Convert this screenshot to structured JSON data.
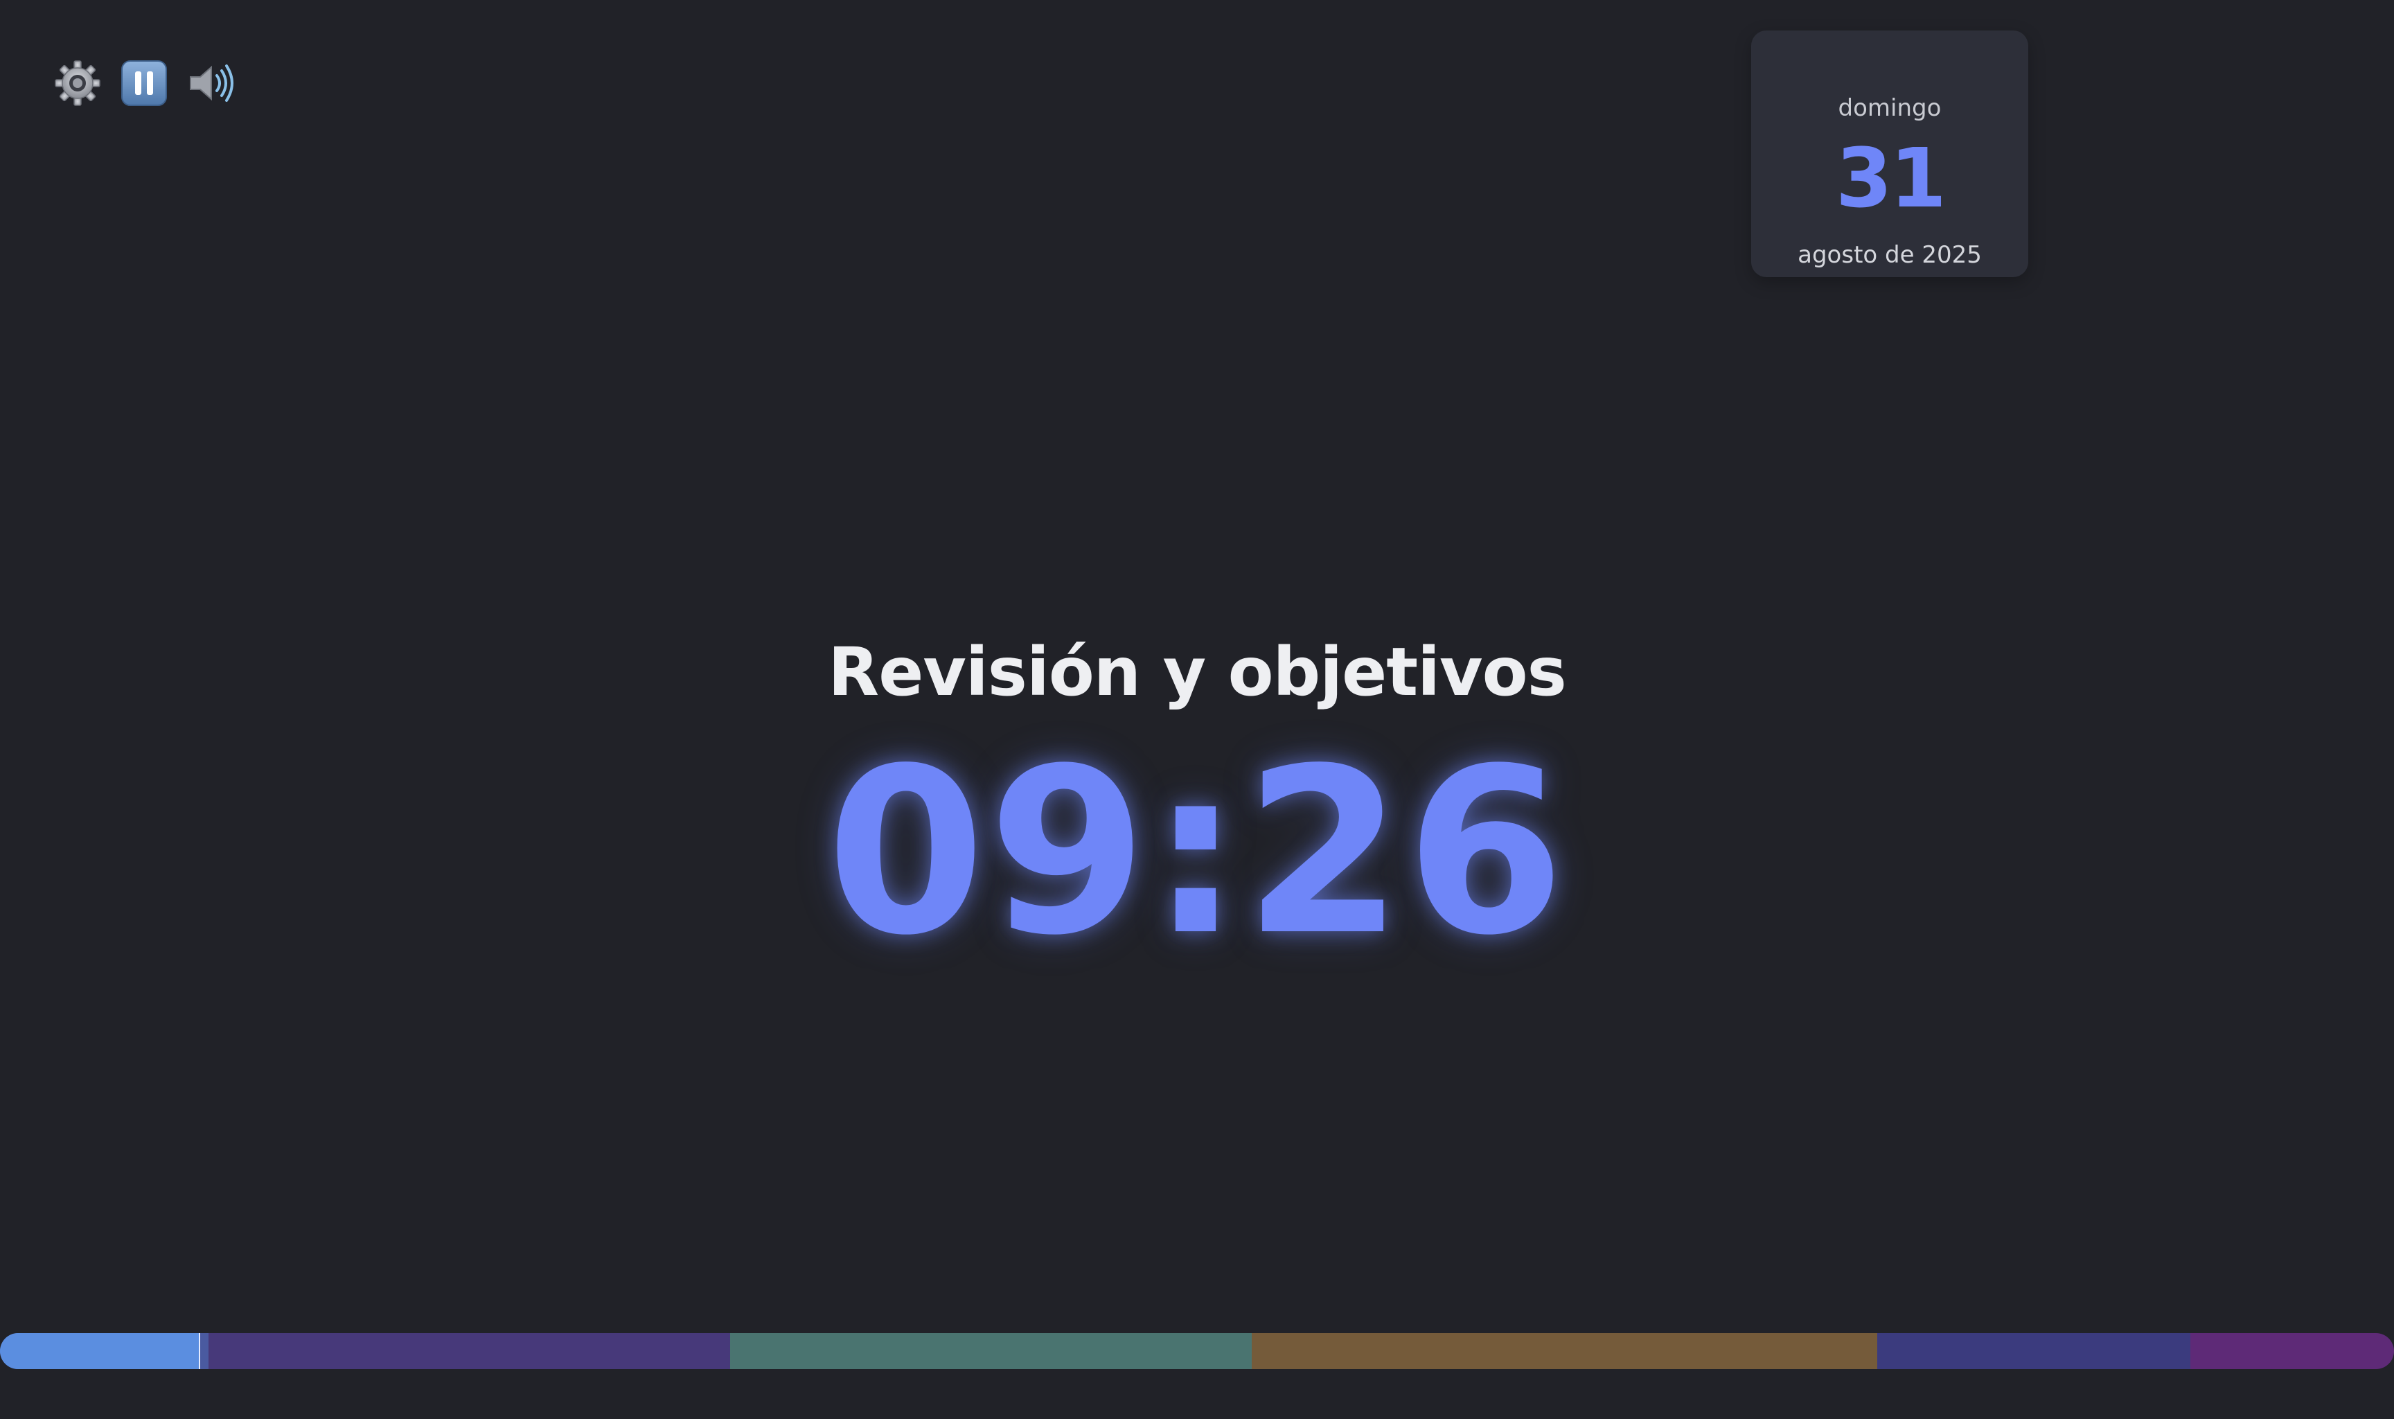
{
  "controls": [
    {
      "name": "settings-button",
      "icon": "gear-icon",
      "symbol": "⚙"
    },
    {
      "name": "pause-button",
      "icon": "pause-icon",
      "symbol": "⏸"
    },
    {
      "name": "volume-button",
      "icon": "speaker-icon",
      "symbol": "🔊"
    }
  ],
  "date": {
    "weekday": "domingo",
    "day": "31",
    "month_year": "agosto de 2025"
  },
  "activity": {
    "title": "Revisión y objetivos"
  },
  "timer": {
    "display": "09:26"
  },
  "colors": {
    "background": "#212228",
    "accent": "#6f86f8",
    "card": "#2d2f39"
  },
  "timeline": {
    "current_segment_progress": 0.955,
    "segments": [
      {
        "name": "segment-1",
        "share": 0.087,
        "color": "#4a5aa0"
      },
      {
        "name": "segment-2",
        "share": 0.218,
        "color": "#47397a"
      },
      {
        "name": "segment-3",
        "share": 0.218,
        "color": "#4a7470"
      },
      {
        "name": "segment-4",
        "share": 0.261,
        "color": "#755b3a"
      },
      {
        "name": "segment-5",
        "share": 0.131,
        "color": "#3b3b7e"
      },
      {
        "name": "segment-6",
        "share": 0.085,
        "color": "#5e2a77"
      }
    ]
  }
}
